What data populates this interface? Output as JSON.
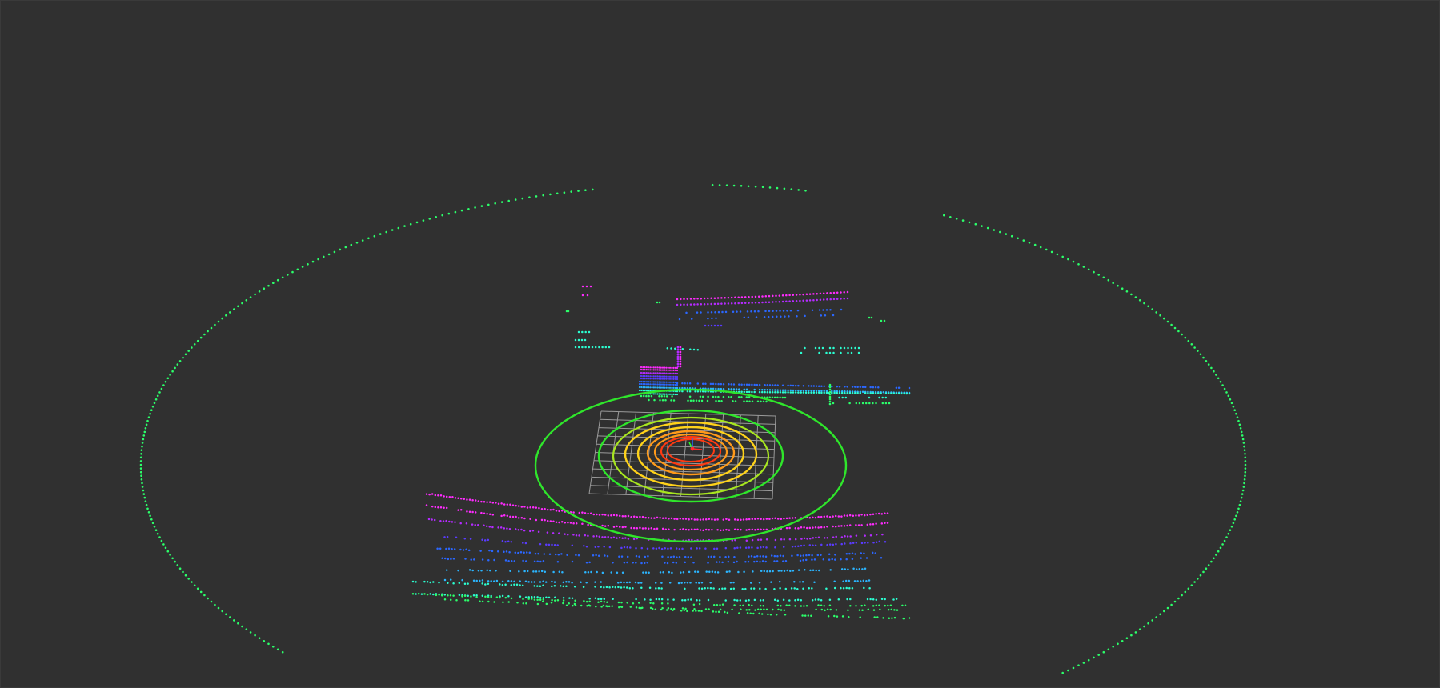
{
  "viewer": {
    "background": "#303030",
    "grid_color": "#9a9a9a",
    "ring_colors": [
      "#2fe62b",
      "#a8e61f",
      "#ffd21a",
      "#ff9a1a",
      "#ff3a12"
    ],
    "point_palette": [
      "#ff2bff",
      "#b42bff",
      "#5a3bff",
      "#2b67ff",
      "#2bb5ff",
      "#2bffd2",
      "#2bff6a"
    ],
    "axis_colors": {
      "x": "#ff2a2a",
      "y": "#2aff2a",
      "z": "#2a6aff"
    }
  }
}
